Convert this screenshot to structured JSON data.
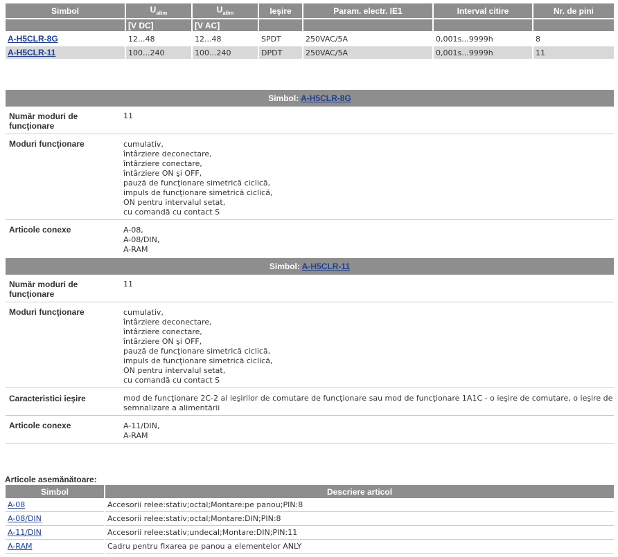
{
  "products_table": {
    "headers": {
      "simbol": "Simbol",
      "u_dc_main": "U",
      "u_dc_sub": "alim",
      "u_ac_main": "U",
      "u_ac_sub": "alim",
      "iesire": "Ieşire",
      "param": "Param. electr. IE1",
      "interval": "Interval citire",
      "pini": "Nr. de pini"
    },
    "units": {
      "u_dc": "[V DC]",
      "u_ac": "[V AC]"
    },
    "rows": [
      {
        "simbol": "A-H5CLR-8G",
        "u_dc": "12...48",
        "u_ac": "12...48",
        "iesire": "SPDT",
        "param": "250VAC/5A",
        "interval": "0,001s...9999h",
        "pini": "8"
      },
      {
        "simbol": "A-H5CLR-11",
        "u_dc": "100...240",
        "u_ac": "100...240",
        "iesire": "DPDT",
        "param": "250VAC/5A",
        "interval": "0,001s...9999h",
        "pini": "11"
      }
    ]
  },
  "details": [
    {
      "header_prefix": "Simbol:",
      "symbol": "A-H5CLR-8G",
      "num_label_1": "Număr moduri de",
      "num_label_2": "funcţionare",
      "num_value": "11",
      "modes_label": "Moduri funcţionare",
      "modes": [
        "cumulativ,",
        "întârziere deconectare,",
        "întârziere conectare,",
        "întârziere ON şi OFF,",
        "pauză de funcţionare simetrică ciclică,",
        "impuls de funcţionare simetrică ciclică,",
        "ON pentru intervalul setat,",
        "cu comandă cu contact S"
      ],
      "related_label": "Articole conexe",
      "related": [
        "A-08,",
        "A-08/DIN,",
        "A-RAM"
      ]
    },
    {
      "header_prefix": "Simbol:",
      "symbol": "A-H5CLR-11",
      "num_label_1": "Număr moduri de",
      "num_label_2": "funcţionare",
      "num_value": "11",
      "modes_label": "Moduri funcţionare",
      "modes": [
        "cumulativ,",
        "întârziere deconectare,",
        "întârziere conectare,",
        "întârziere ON şi OFF,",
        "pauză de funcţionare simetrică ciclică,",
        "impuls de funcţionare simetrică ciclică,",
        "ON pentru intervalul setat,",
        "cu comandă cu contact S"
      ],
      "output_label": "Caracteristici ieşire",
      "output_lines": [
        "mod de funcţionare 2C-2 al ieşirilor de comutare de funcţionare sau mod de funcţionare 1A1C - o ieşire de comutare, o ieşire de",
        "semnalizare a alimentării"
      ],
      "related_label": "Articole conexe",
      "related": [
        "A-11/DIN,",
        "A-RAM"
      ]
    }
  ],
  "similar": {
    "title": "Articole asemănătoare:",
    "headers": {
      "simbol": "Simbol",
      "descriere": "Descriere articol"
    },
    "rows": [
      {
        "simbol": "A-08",
        "descriere": "Accesorii releе:stativ;octal;Montare:pe panou;PIN:8"
      },
      {
        "simbol": "A-08/DIN",
        "descriere": "Accesorii releе:stativ;octal;Montare:DIN;PIN:8"
      },
      {
        "simbol": "A-11/DIN",
        "descriere": "Accesorii releе:stativ;undecal;Montare:DIN;PIN:11"
      },
      {
        "simbol": "A-RAM",
        "descriere": "Cadru pentru fixarea pe panou a elementelor ANLY"
      }
    ]
  }
}
